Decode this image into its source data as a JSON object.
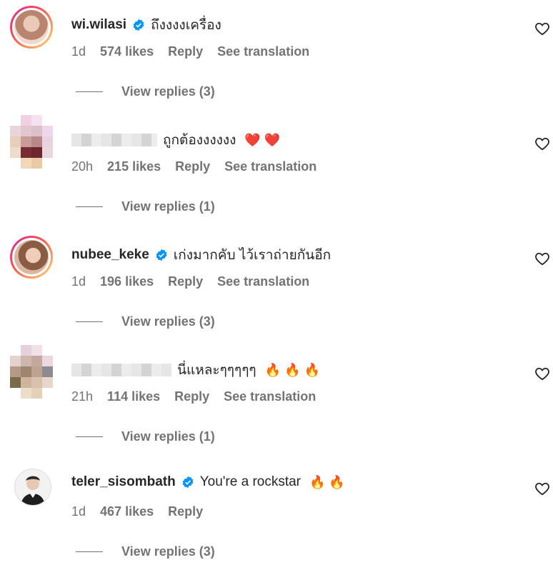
{
  "comments": [
    {
      "username": "wi.wilasi",
      "text": "ถึงงงงเครื่อง",
      "emojis": "",
      "time": "1d",
      "likes": "574 likes",
      "reply": "Reply",
      "translate": "See translation",
      "view_replies": "View replies (3)"
    },
    {
      "username": "",
      "text": "ถูกต้องงงงงง",
      "emojis": "❤️ ❤️",
      "time": "20h",
      "likes": "215 likes",
      "reply": "Reply",
      "translate": "See translation",
      "view_replies": "View replies (1)"
    },
    {
      "username": "nubee_keke",
      "text": "เก่งมากคับ ไว้เราถ่ายกันอีก",
      "emojis": "",
      "time": "1d",
      "likes": "196 likes",
      "reply": "Reply",
      "translate": "See translation",
      "view_replies": "View replies (3)"
    },
    {
      "username": "",
      "text": "นี่แหละๆๆๆๆๆ",
      "emojis": "🔥 🔥 🔥",
      "time": "21h",
      "likes": "114 likes",
      "reply": "Reply",
      "translate": "See translation",
      "view_replies": "View replies (1)"
    },
    {
      "username": "teler_sisombath",
      "text": "You're a rockstar",
      "emojis": "🔥 🔥",
      "time": "1d",
      "likes": "467 likes",
      "reply": "Reply",
      "translate": "",
      "view_replies": "View replies (3)"
    }
  ],
  "colors": {
    "verified": "#0095f6",
    "muted": "#737373",
    "text": "#262626"
  },
  "icons": {
    "verified": "verified-badge-icon",
    "like": "heart-outline-icon"
  }
}
